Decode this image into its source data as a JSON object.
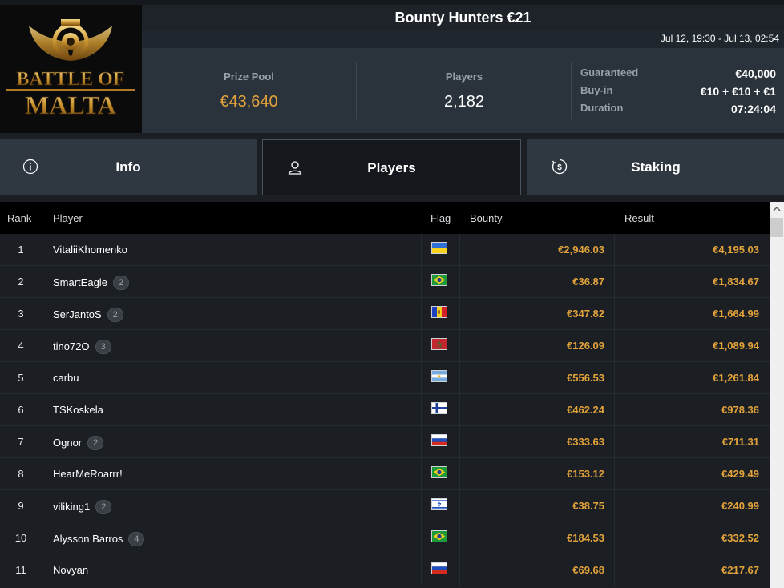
{
  "header": {
    "logo_text_line1": "BATTLE OF",
    "logo_text_line2": "MALTA",
    "title": "Bounty Hunters €21",
    "date_range": "Jul 12, 19:30 - Jul 13, 02:54"
  },
  "stats": {
    "prize_pool_label": "Prize Pool",
    "prize_pool_value": "€43,640",
    "players_label": "Players",
    "players_value": "2,182",
    "guaranteed_label": "Guaranteed",
    "guaranteed_value": "€40,000",
    "buyin_label": "Buy-in",
    "buyin_value": "€10 + €10 + €1",
    "duration_label": "Duration",
    "duration_value": "07:24:04"
  },
  "tabs": [
    {
      "label": "Info",
      "icon": "info-icon"
    },
    {
      "label": "Players",
      "icon": "user-icon",
      "active": true
    },
    {
      "label": "Staking",
      "icon": "dollar-coin-icon"
    }
  ],
  "table": {
    "headers": {
      "rank": "Rank",
      "player": "Player",
      "flag": "Flag",
      "bounty": "Bounty",
      "result": "Result"
    },
    "rows": [
      {
        "rank": "1",
        "player": "VitaliiKhomenko",
        "badge": "",
        "flag": "ukraine",
        "bounty": "€2,946.03",
        "result": "€4,195.03"
      },
      {
        "rank": "2",
        "player": "SmartEagle",
        "badge": "2",
        "flag": "brazil",
        "bounty": "€36.87",
        "result": "€1,834.67"
      },
      {
        "rank": "3",
        "player": "SerJantoS",
        "badge": "2",
        "flag": "moldova",
        "bounty": "€347.82",
        "result": "€1,664.99"
      },
      {
        "rank": "4",
        "player": "tino72O",
        "badge": "3",
        "flag": "morocco",
        "bounty": "€126.09",
        "result": "€1,089.94"
      },
      {
        "rank": "5",
        "player": "carbu",
        "badge": "",
        "flag": "argentina",
        "bounty": "€556.53",
        "result": "€1,261.84"
      },
      {
        "rank": "6",
        "player": "TSKoskela",
        "badge": "",
        "flag": "finland",
        "bounty": "€462.24",
        "result": "€978.36"
      },
      {
        "rank": "7",
        "player": "Ognor",
        "badge": "2",
        "flag": "russia",
        "bounty": "€333.63",
        "result": "€711.31"
      },
      {
        "rank": "8",
        "player": "HearMeRoarrr!",
        "badge": "",
        "flag": "brazil",
        "bounty": "€153.12",
        "result": "€429.49"
      },
      {
        "rank": "9",
        "player": "viliking1",
        "badge": "2",
        "flag": "israel",
        "bounty": "€38.75",
        "result": "€240.99"
      },
      {
        "rank": "10",
        "player": "Alysson Barros",
        "badge": "4",
        "flag": "brazil",
        "bounty": "€184.53",
        "result": "€332.52"
      },
      {
        "rank": "11",
        "player": "Novyan",
        "badge": "",
        "flag": "russia",
        "bounty": "€69.68",
        "result": "€217.67"
      }
    ]
  },
  "colors": {
    "accent_gold": "#e3a33b",
    "bg_dark": "#1b1f24",
    "panel": "#2a323b"
  }
}
